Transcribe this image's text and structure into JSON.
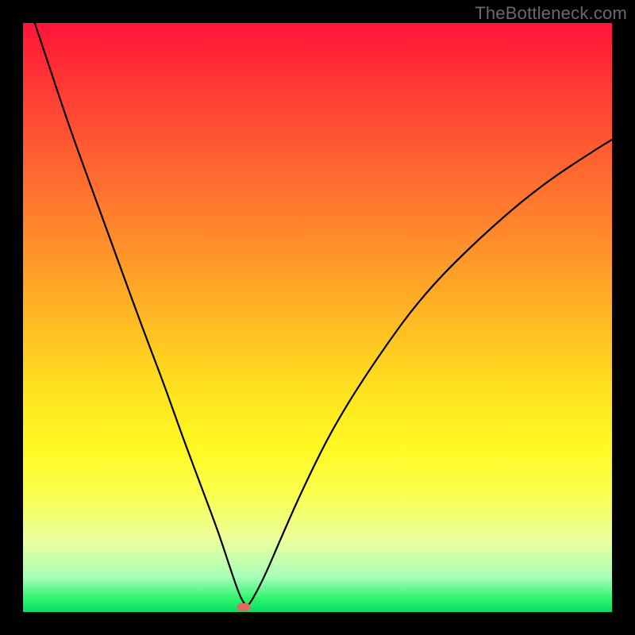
{
  "watermark": "TheBottleneck.com",
  "chart_data": {
    "type": "line",
    "title": "",
    "xlabel": "",
    "ylabel": "",
    "x_range": [
      0,
      100
    ],
    "y_range": [
      0,
      100
    ],
    "background_gradient": {
      "direction": "vertical",
      "stops": [
        {
          "pos": 0.0,
          "color": "#ff1537"
        },
        {
          "pos": 0.12,
          "color": "#ff3d36"
        },
        {
          "pos": 0.26,
          "color": "#ff6a2f"
        },
        {
          "pos": 0.4,
          "color": "#ff972a"
        },
        {
          "pos": 0.52,
          "color": "#ffbf23"
        },
        {
          "pos": 0.63,
          "color": "#ffe41f"
        },
        {
          "pos": 0.72,
          "color": "#fff923"
        },
        {
          "pos": 0.8,
          "color": "#f9ff4e"
        },
        {
          "pos": 0.88,
          "color": "#e9ffa0"
        },
        {
          "pos": 0.94,
          "color": "#a7ffb8"
        },
        {
          "pos": 0.98,
          "color": "#29f26b"
        },
        {
          "pos": 1.0,
          "color": "#06dd64"
        }
      ]
    },
    "series": [
      {
        "name": "bottleneck-curve",
        "x": [
          2,
          5,
          8,
          12,
          16,
          20,
          24,
          27,
          30,
          33,
          35,
          36,
          37,
          38,
          39,
          41,
          44,
          48,
          53,
          60,
          68,
          78,
          88,
          98,
          100
        ],
        "y": [
          100,
          91,
          82,
          71,
          60,
          49,
          38.5,
          30,
          22,
          14,
          8,
          5,
          2.3,
          0.8,
          2.2,
          6,
          13,
          22,
          32,
          43,
          54,
          64,
          72.5,
          79,
          80.2
        ]
      }
    ],
    "marker": {
      "x": 37.5,
      "y": 0.8,
      "color": "#e06a5f"
    },
    "grid": false,
    "legend": false,
    "axes_visible": false
  }
}
